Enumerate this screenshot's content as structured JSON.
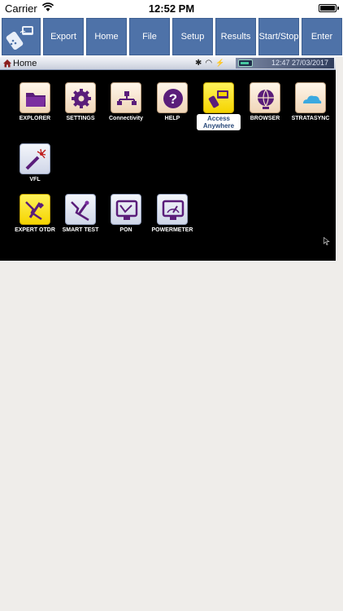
{
  "status_bar": {
    "carrier": "Carrier",
    "time": "12:52 PM"
  },
  "toolbar": {
    "buttons": [
      "Export",
      "Home",
      "File",
      "Setup",
      "Results",
      "Start/Stop",
      "Enter"
    ],
    "color": "#4e72a8"
  },
  "device": {
    "header": {
      "title": "Home",
      "clock": "12:47 27/03/2017"
    },
    "apps": [
      {
        "label": "EXPLORER",
        "icon": "folder-icon"
      },
      {
        "label": "SETTINGS",
        "icon": "gear-icon"
      },
      {
        "label": "Connectivity",
        "icon": "network-icon"
      },
      {
        "label": "HELP",
        "icon": "help-icon"
      },
      {
        "label": "Access Anywhere",
        "icon": "remote-access-icon"
      },
      {
        "label": "BROWSER",
        "icon": "globe-icon"
      },
      {
        "label": "STRATASYNC",
        "icon": "cloud-icon"
      },
      {
        "label": "VFL",
        "icon": "laser-icon"
      },
      {
        "label": "EXPERT OTDR",
        "icon": "otdr-icon"
      },
      {
        "label": "SMART TEST",
        "icon": "smart-test-icon"
      },
      {
        "label": "PON",
        "icon": "pon-icon"
      },
      {
        "label": "POWERMETER",
        "icon": "powermeter-icon"
      }
    ]
  }
}
